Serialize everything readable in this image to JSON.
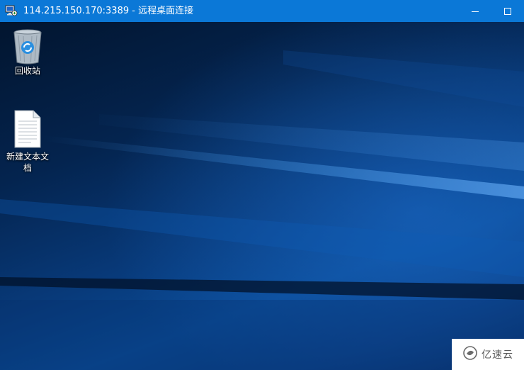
{
  "window": {
    "title": "114.215.150.170:3389 - 远程桌面连接",
    "icon": "remote-desktop-icon",
    "controls": [
      "minimize-icon",
      "maximize-icon"
    ],
    "accent": "#0b78d7"
  },
  "desktop": {
    "icons": [
      {
        "label": "回收站",
        "icon": "recycle-bin-icon"
      },
      {
        "label": "新建文本文档",
        "icon": "text-document-icon"
      }
    ],
    "wallpaper": "windows-10-blue"
  },
  "watermark": {
    "text": "亿速云",
    "icon": "yisu-cloud-logo"
  }
}
